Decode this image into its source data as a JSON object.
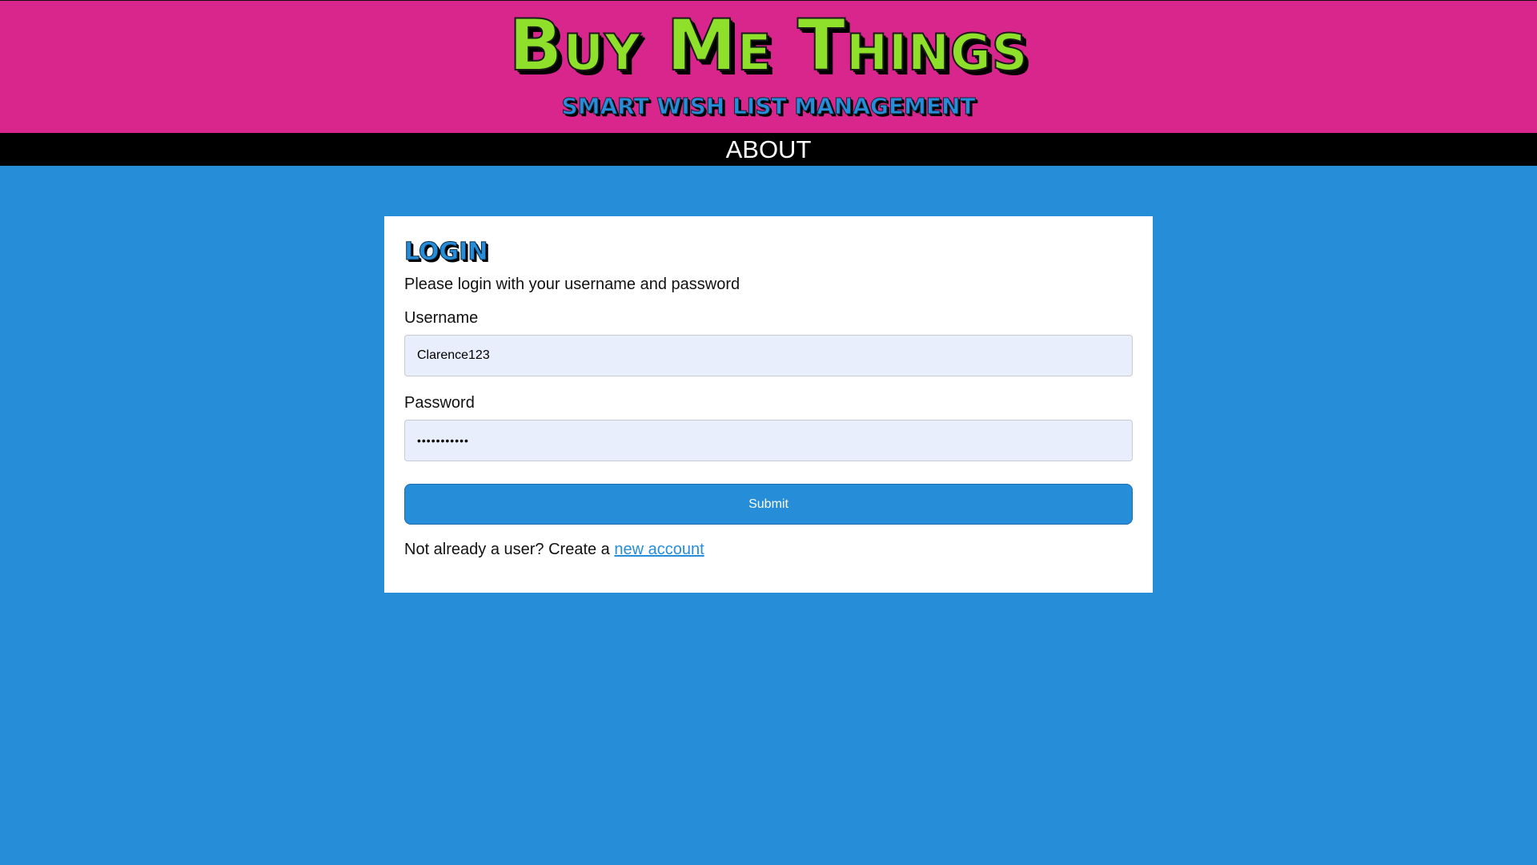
{
  "header": {
    "title": "Buy Me Things",
    "subtitle": "Smart wish list management",
    "background_color": "#d9268c",
    "title_color": "#8ee02a"
  },
  "nav": {
    "items": [
      {
        "label": "ABOUT"
      }
    ]
  },
  "login": {
    "title": "LOGIN",
    "description": "Please login with your username and password",
    "username_label": "Username",
    "username_value": "Clarence123",
    "password_label": "Password",
    "password_value": "•••••••••••",
    "submit_label": "Submit",
    "register_prefix": "Not already a user? Create a ",
    "register_link": "new account"
  },
  "colors": {
    "page_background": "#268dd9",
    "accent": "#268dd9",
    "nav_background": "#000000",
    "input_background": "#e8eefb"
  }
}
